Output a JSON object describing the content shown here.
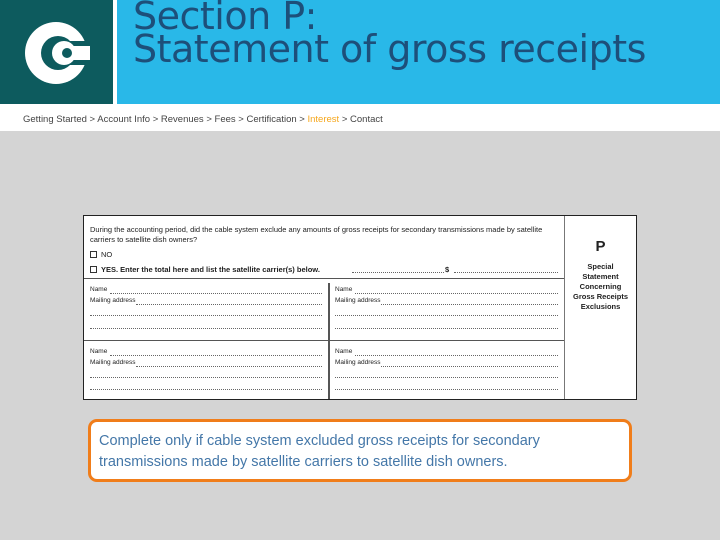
{
  "header": {
    "logo_icon": "copyright-office-c-logo-icon",
    "title_line1": "Section P:",
    "title_line2": "Statement of gross receipts"
  },
  "breadcrumb": {
    "items": [
      "Getting Started",
      "Account Info",
      "Revenues",
      "Fees",
      "Certification",
      "Interest",
      "Contact"
    ],
    "separator": ">",
    "active_item": "Interest",
    "active_color": "#f6a71c"
  },
  "form_excerpt": {
    "question": "During the accounting period, did the cable system exclude any amounts of gross receipts for secondary transmissions made by satellite carriers to satellite dish owners?",
    "option_no": "NO",
    "option_yes": "YES. Enter the total here and list the satellite carrier(s) below.",
    "amount_symbol": "$",
    "side_letter": "P",
    "side_label_lines": [
      "Special",
      "Statement",
      "Concerning",
      "Gross Receipts",
      "Exclusions"
    ],
    "name_label": "Name",
    "mailing_address_label": "Mailing address"
  },
  "note": {
    "text": "Complete only if cable system excluded gross receipts for secondary transmissions made by satellite carriers to satellite dish owners."
  },
  "colors": {
    "header_bg": "#29b8e8",
    "logo_bg": "#0d5b5e",
    "title": "#1d4f7a",
    "note_border": "#f07d1a",
    "note_text": "#4477a8"
  }
}
